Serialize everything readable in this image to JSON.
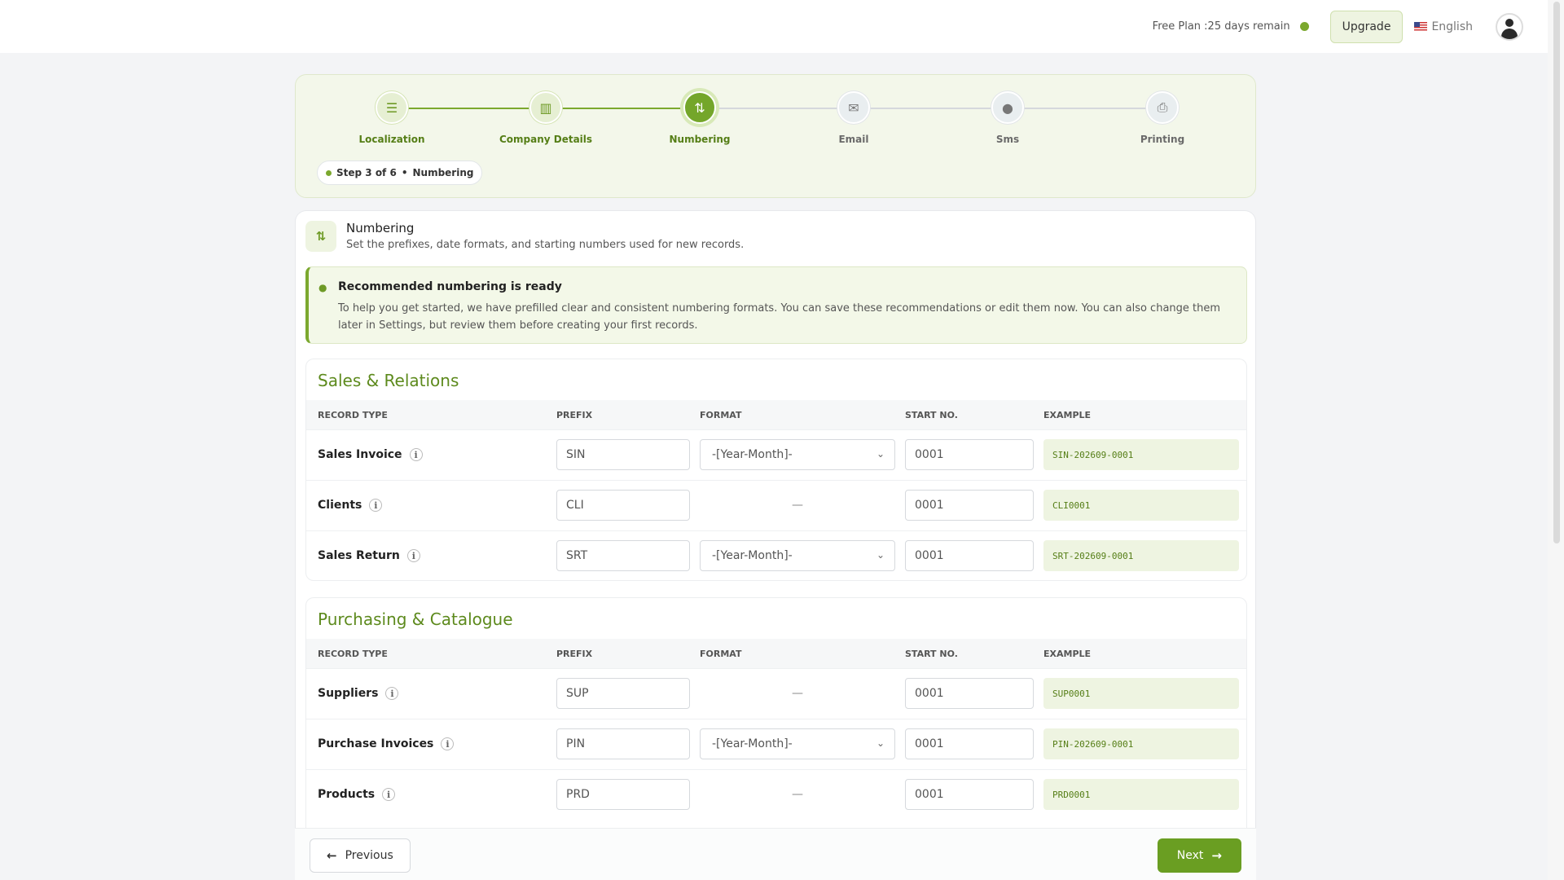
{
  "topbar": {
    "plan_text": "Free Plan :25 days remain",
    "upgrade_label": "Upgrade",
    "language": "English",
    "flag_icon": "us-flag-icon",
    "avatar_icon": "user-avatar-icon"
  },
  "colors": {
    "accent": "#6a9e22",
    "accent_light": "#eef4e1",
    "text": "#222222"
  },
  "stepper": {
    "steps": [
      {
        "label": "Localization",
        "icon": "sliders-icon",
        "state": "done"
      },
      {
        "label": "Company Details",
        "icon": "building-icon",
        "state": "done"
      },
      {
        "label": "Numbering",
        "icon": "sort-arrows-icon",
        "state": "active"
      },
      {
        "label": "Email",
        "icon": "envelope-icon",
        "state": "pending"
      },
      {
        "label": "Sms",
        "icon": "chat-bubble-icon",
        "state": "pending"
      },
      {
        "label": "Printing",
        "icon": "printer-icon",
        "state": "pending"
      }
    ],
    "badge_step": "Step 3 of 6",
    "badge_separator": "•",
    "badge_name": "Numbering"
  },
  "header": {
    "title": "Numbering",
    "subtitle": "Set the prefixes, date formats, and starting numbers used for new records."
  },
  "alert": {
    "icon": "lightbulb-icon",
    "title": "Recommended numbering is ready",
    "text": "To help you get started, we have prefilled clear and consistent numbering formats. You can save these recommendations or edit them now. You can also change them later in Settings, but review them before creating your first records."
  },
  "columns": {
    "record_type": "RECORD TYPE",
    "prefix": "PREFIX",
    "format": "FORMAT",
    "start_no": "START NO.",
    "example": "EXAMPLE"
  },
  "sections": [
    {
      "title": "Sales & Relations",
      "rows": [
        {
          "name": "Sales Invoice",
          "prefix": "SIN",
          "format": "-[Year-Month]-",
          "start": "0001",
          "example": "SIN-202609-0001"
        },
        {
          "name": "Clients",
          "prefix": "CLI",
          "format": "—",
          "start": "0001",
          "example": "CLI0001"
        },
        {
          "name": "Sales Return",
          "prefix": "SRT",
          "format": "-[Year-Month]-",
          "start": "0001",
          "example": "SRT-202609-0001"
        }
      ]
    },
    {
      "title": "Purchasing & Catalogue",
      "rows": [
        {
          "name": "Suppliers",
          "prefix": "SUP",
          "format": "—",
          "start": "0001",
          "example": "SUP0001"
        },
        {
          "name": "Purchase Invoices",
          "prefix": "PIN",
          "format": "-[Year-Month]-",
          "start": "0001",
          "example": "PIN-202609-0001"
        },
        {
          "name": "Products",
          "prefix": "PRD",
          "format": "—",
          "start": "0001",
          "example": "PRD0001"
        }
      ]
    }
  ],
  "footer": {
    "previous_label": "Previous",
    "next_label": "Next"
  }
}
